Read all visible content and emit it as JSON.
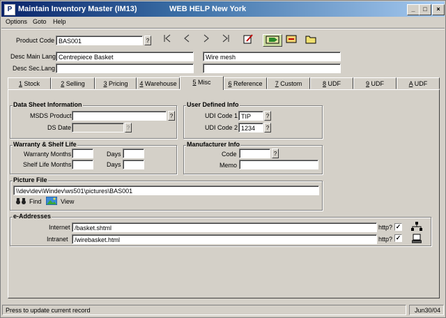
{
  "window": {
    "title": "Maintain Inventory Master (IM13)",
    "help_label": "WEB HELP",
    "location": "New York",
    "min_label": "_",
    "max_label": "□",
    "close_label": "×"
  },
  "menu": [
    {
      "label": "Options",
      "accel": "O"
    },
    {
      "label": "Goto",
      "accel": "G"
    },
    {
      "label": "Help",
      "accel": "H"
    }
  ],
  "header": {
    "product_code_label": "Product Code",
    "product_code_value": "BAS001",
    "desc_main_label": "Desc Main Lang",
    "desc_main_value": "Centrepiece Basket",
    "desc_main_value2": "Wire mesh",
    "desc_sec_label": "Desc Sec.Lang",
    "desc_sec_value": "",
    "desc_sec_value2": ""
  },
  "tabs": [
    {
      "num": "1",
      "label": "Stock"
    },
    {
      "num": "2",
      "label": "Selling"
    },
    {
      "num": "3",
      "label": "Pricing"
    },
    {
      "num": "4",
      "label": "Warehouse"
    },
    {
      "num": "5",
      "label": "Misc"
    },
    {
      "num": "6",
      "label": "Reference"
    },
    {
      "num": "7",
      "label": "Custom"
    },
    {
      "num": "8",
      "label": "UDF"
    },
    {
      "num": "9",
      "label": "UDF"
    },
    {
      "num": "A",
      "label": "UDF"
    }
  ],
  "active_tab": "Misc",
  "data_sheet": {
    "title": "Data Sheet Information",
    "msds_label": "MSDS Product",
    "msds_value": "",
    "ds_date_label": "DS Date",
    "ds_date_value": ""
  },
  "warranty": {
    "title": "Warranty & Shelf Life",
    "warranty_label": "Warranty Months",
    "warranty_value": "",
    "shelf_label": "Shelf Life Months",
    "shelf_value": "",
    "days_label": "Days",
    "days1_value": "",
    "days2_value": ""
  },
  "user_defined": {
    "title": "User Defined Info",
    "udi1_label": "UDI Code 1",
    "udi1_value": "TIP",
    "udi2_label": "UDI Code 2",
    "udi2_value": "1234"
  },
  "manufacturer": {
    "title": "Manufacturer Info",
    "code_label": "Code",
    "code_value": "",
    "memo_label": "Memo",
    "memo_value": ""
  },
  "picture": {
    "title": "Picture File",
    "path": "\\\\dev\\dev\\Windev\\ws501\\pictures\\BAS001",
    "find_label": "Find",
    "view_label": "View"
  },
  "eaddresses": {
    "title": "e-Addresses",
    "internet_label": "Internet",
    "internet_value": "/basket.shtml",
    "intranet_label": "Intranet",
    "intranet_value": "/wirebasket.html",
    "http_label": "http?",
    "internet_http": true,
    "intranet_http": true
  },
  "lookup_label": "?",
  "status": {
    "message": "Press to update current record",
    "date": "Jun30/04"
  },
  "colors": {
    "titlebar_start": "#0a246a",
    "titlebar_end": "#a6caf0",
    "face": "#d4d0c8"
  }
}
